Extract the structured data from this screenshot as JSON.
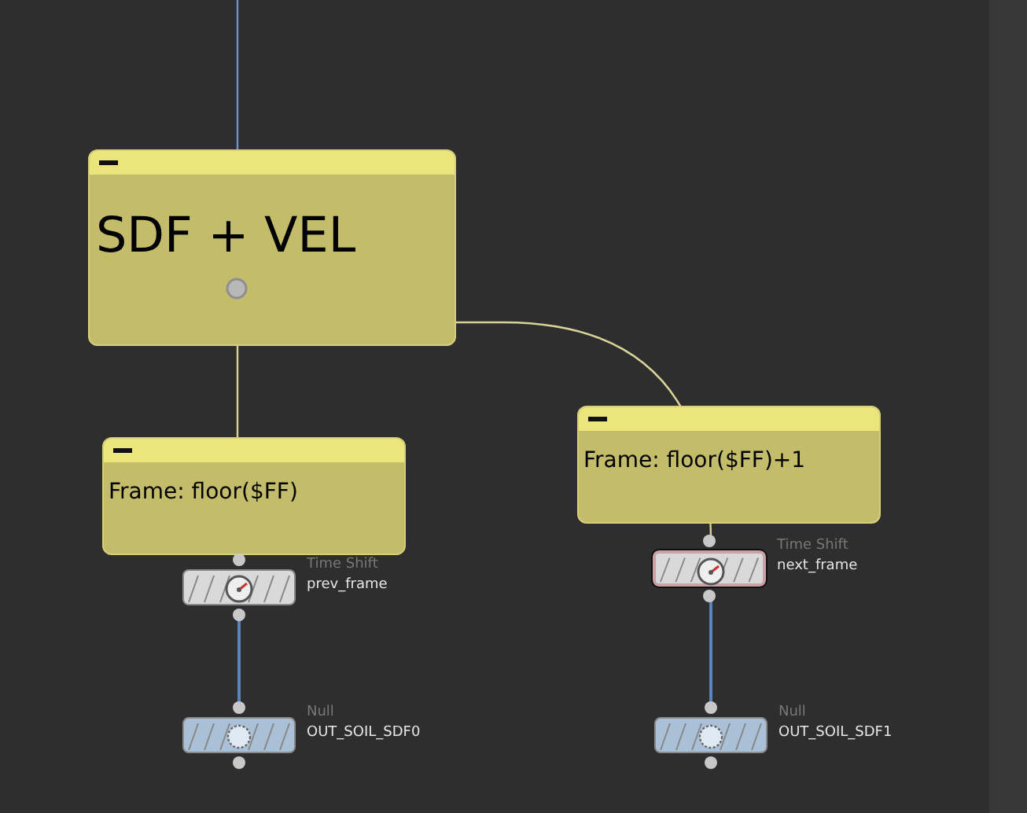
{
  "sticky_notes": [
    {
      "text": "SDF + VEL",
      "kind": "heading"
    },
    {
      "text": "Frame: floor($FF)",
      "kind": "note"
    },
    {
      "text": "Frame: floor($FF)+1",
      "kind": "note"
    }
  ],
  "nodes": [
    {
      "kind": "timeshift",
      "type_label": "Time Shift",
      "name": "next_frame",
      "selected": true
    },
    {
      "kind": "timeshift",
      "type_label": "Time Shift",
      "name": "prev_frame",
      "selected": false
    },
    {
      "kind": "null",
      "type_label": "Null",
      "name": "OUT_SOIL_SDF0",
      "selected": false
    },
    {
      "kind": "null",
      "type_label": "Null",
      "name": "OUT_SOIL_SDF1",
      "selected": false
    }
  ]
}
